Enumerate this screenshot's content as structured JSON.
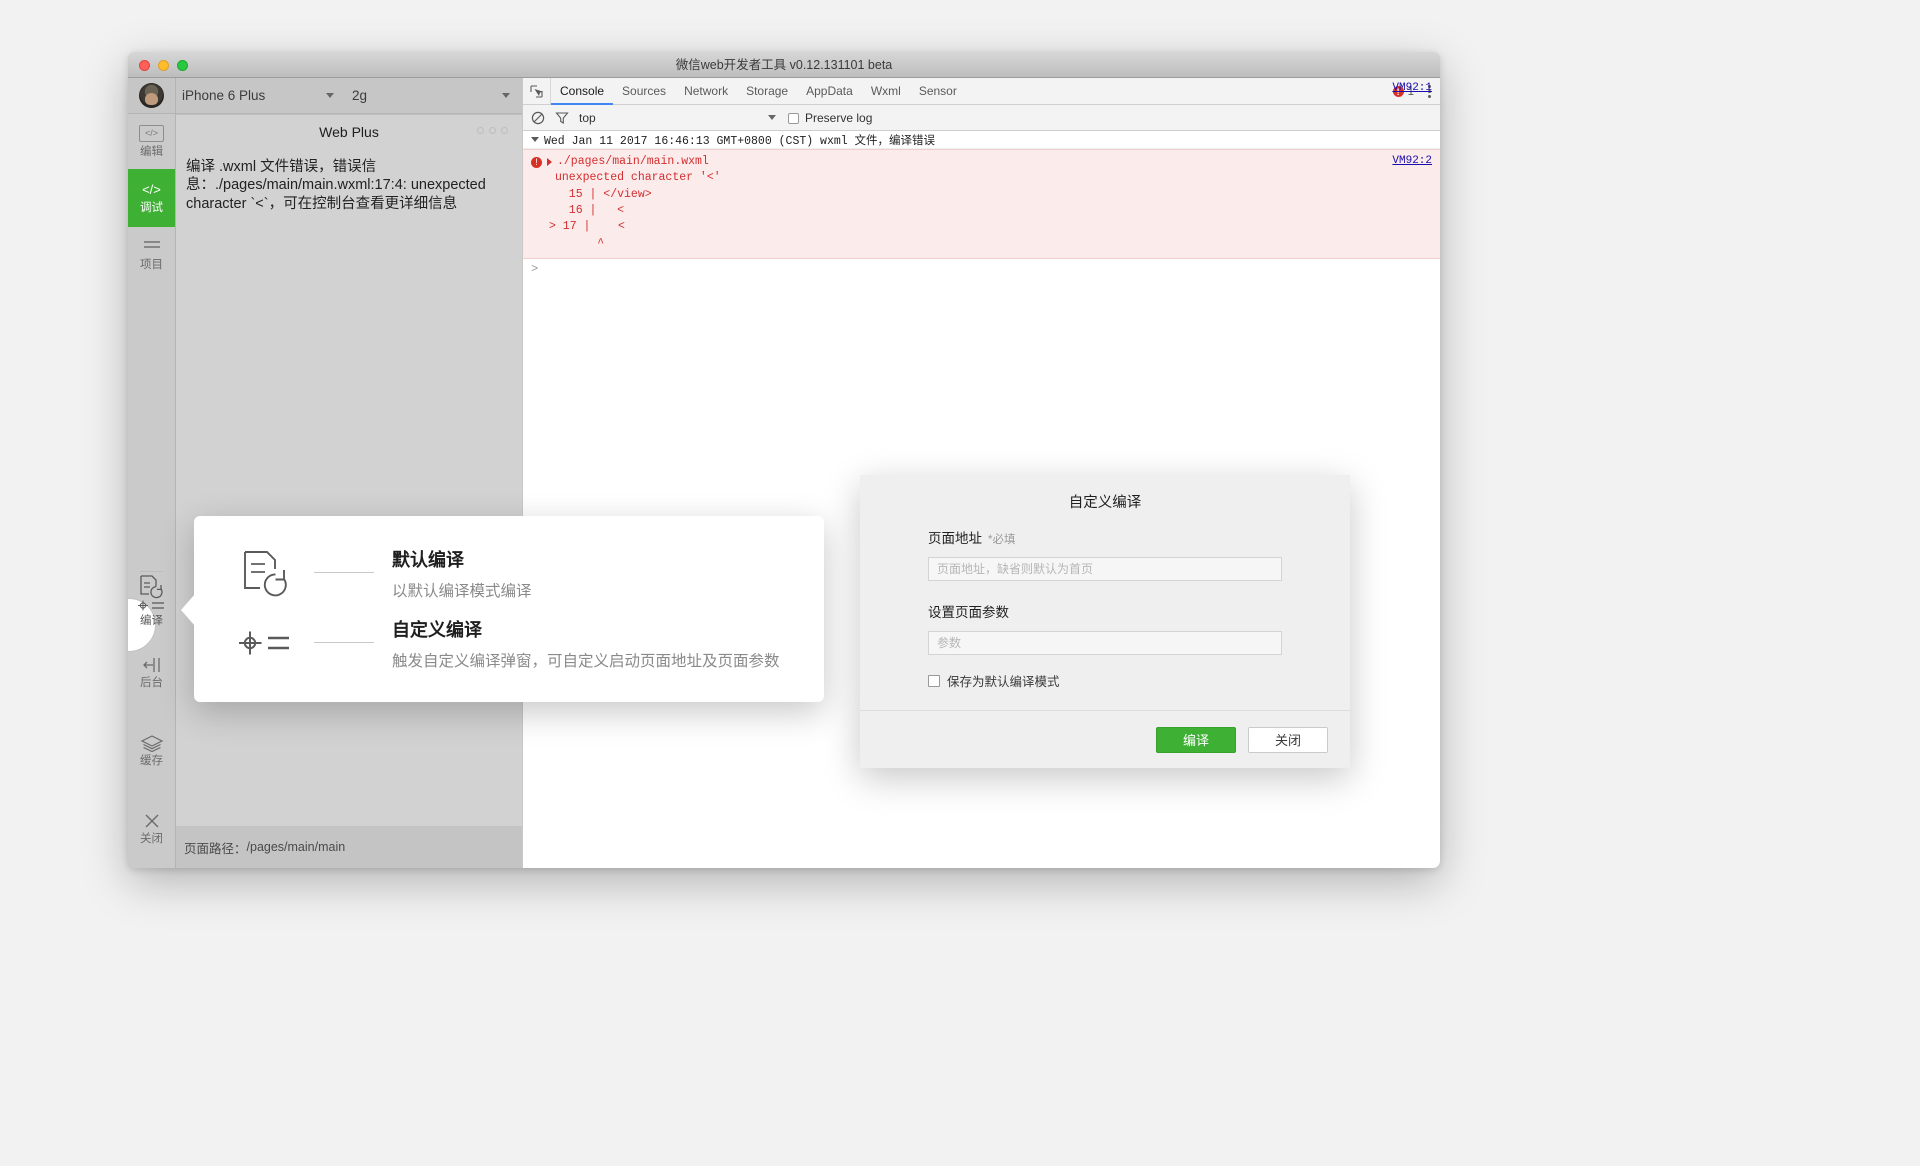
{
  "window": {
    "title": "微信web开发者工具 v0.12.131101 beta",
    "traffic": {
      "close": "close-button",
      "minimize": "minimize-button",
      "zoom": "zoom-button"
    }
  },
  "rail": {
    "items": [
      {
        "icon": "</>",
        "label": "编辑",
        "name": "editor",
        "active": false,
        "boxed": true
      },
      {
        "icon": "</>",
        "label": "调试",
        "name": "debugger",
        "active": true,
        "boxed": false
      },
      {
        "icon": "≡",
        "label": "项目",
        "name": "project",
        "active": false,
        "boxed": false
      }
    ],
    "bottom_items": [
      {
        "icon": "compile",
        "label": "编译",
        "name": "compile",
        "highlighted": true
      },
      {
        "icon": "background",
        "label": "后台",
        "name": "background",
        "highlighted": false
      },
      {
        "icon": "cache",
        "label": "缓存",
        "name": "cache",
        "highlighted": false
      },
      {
        "icon": "×",
        "label": "关闭",
        "name": "close",
        "highlighted": false
      }
    ]
  },
  "simulator": {
    "device": "iPhone 6 Plus",
    "network": "2g",
    "page_title": "Web Plus",
    "error_text": "编译 .wxml 文件错误，错误信息：./pages/main/main.wxml:17:4: unexpected character `<`，可在控制台查看更详细信息",
    "footer_label": "页面路径：",
    "footer_path": "/pages/main/main"
  },
  "devtools": {
    "tabs": [
      {
        "label": "Console",
        "active": true
      },
      {
        "label": "Sources",
        "active": false
      },
      {
        "label": "Network",
        "active": false
      },
      {
        "label": "Storage",
        "active": false
      },
      {
        "label": "AppData",
        "active": false
      },
      {
        "label": "Wxml",
        "active": false
      },
      {
        "label": "Sensor",
        "active": false
      }
    ],
    "error_count": "1",
    "filter": {
      "context": "top",
      "preserve_log_label": "Preserve log",
      "preserve_log_checked": false
    },
    "log": {
      "group_header": "Wed Jan 11 2017 16:46:13 GMT+0800 (CST) wxml 文件，编译错误",
      "group_link": "VM92:1",
      "error_link": "VM92:2",
      "error_file": "./pages/main/main.wxml",
      "error_message": "unexpected character '<'",
      "code_lines": [
        "  15 | </view>",
        "  16 |   <",
        "> 17 |    <",
        "       ^"
      ]
    },
    "prompt": ">"
  },
  "coach": {
    "rows": [
      {
        "icon": "compile-clock-icon",
        "title": "默认编译",
        "subtitle": "以默认编译模式编译"
      },
      {
        "icon": "settings-list-icon",
        "title": "自定义编译",
        "subtitle": "触发自定义编译弹窗，可自定义启动页面地址及页面参数"
      }
    ]
  },
  "modal": {
    "title": "自定义编译",
    "page_url": {
      "label": "页面地址",
      "required_mark": "*必填",
      "value": "",
      "placeholder": "页面地址，缺省则默认为首页"
    },
    "page_params": {
      "label": "设置页面参数",
      "value": "",
      "placeholder": "参数"
    },
    "save_default_label": "保存为默认编译模式",
    "save_default_checked": false,
    "buttons": {
      "primary": "编译",
      "secondary": "关闭"
    }
  },
  "colors": {
    "accent_green": "#3eb034",
    "tab_underline": "#4285f4",
    "error_red": "#d93025",
    "error_bg": "#fcebeb",
    "link_blue": "#1a0dab"
  }
}
